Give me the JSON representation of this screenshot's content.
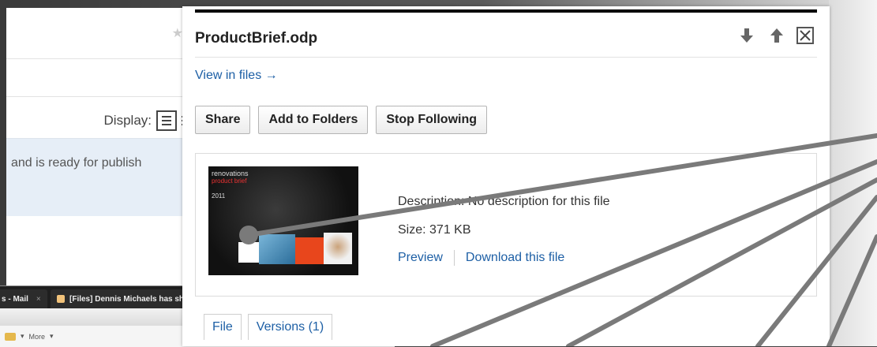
{
  "background_window": {
    "display_label": "Display:",
    "message_text": "and is ready for publish"
  },
  "browser": {
    "tabs": [
      {
        "label": "s - Mail"
      },
      {
        "label": "[Files] Dennis Michaels has shared a..."
      }
    ],
    "toolbar_more": "More"
  },
  "panel": {
    "title": "ProductBrief.odp",
    "view_in_files": "View in files →",
    "buttons": {
      "share": "Share",
      "add_to_folders": "Add to Folders",
      "stop_following": "Stop Following"
    },
    "file": {
      "description": "Description: No description for this file",
      "size": "Size: 371 KB",
      "preview_link": "Preview",
      "download_link": "Download this file",
      "thumbnail_text_1": "renovations",
      "thumbnail_text_2": "product brief",
      "thumbnail_text_3": "2011"
    },
    "tabs": [
      {
        "label": "File"
      },
      {
        "label": "Versions (1)"
      }
    ]
  },
  "colors": {
    "link": "#1d5fa5",
    "header_bar": "#000000",
    "callout": "#7a7a7a"
  }
}
